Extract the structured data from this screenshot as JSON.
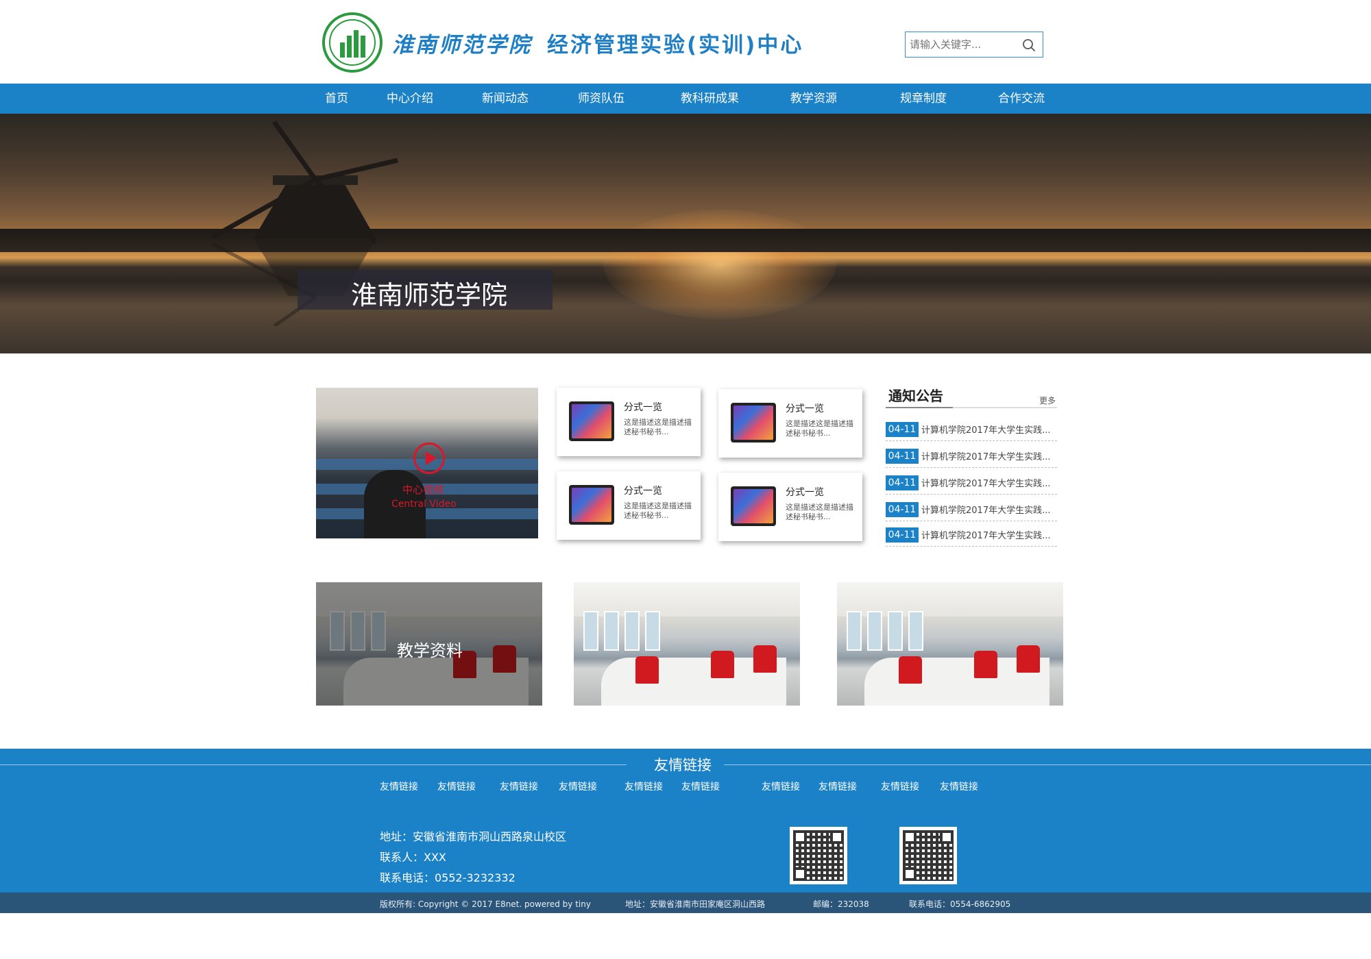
{
  "header": {
    "school_name": "淮南师范学院",
    "center_name": "经济管理实验(实训)中心",
    "search_placeholder": "请输入关键字..."
  },
  "nav": {
    "items": [
      {
        "label": "首页"
      },
      {
        "label": "中心介绍"
      },
      {
        "label": "新闻动态"
      },
      {
        "label": "师资队伍"
      },
      {
        "label": "教科研成果"
      },
      {
        "label": "教学资源"
      },
      {
        "label": "规章制度"
      },
      {
        "label": "合作交流"
      }
    ]
  },
  "banner": {
    "caption": "淮南师范学院",
    "slide_count": 4,
    "active_slide": 1
  },
  "video": {
    "title": "中心视频",
    "subtitle": "Central Video",
    "icon": "play-icon"
  },
  "cards": [
    {
      "title": "分式一览",
      "desc": "这是描述这是描述描述秘书秘书..."
    },
    {
      "title": "分式一览",
      "desc": "这是描述这是描述描述秘书秘书..."
    },
    {
      "title": "分式一览",
      "desc": "这是描述这是描述描述秘书秘书..."
    },
    {
      "title": "分式一览",
      "desc": "这是描述这是描述描述秘书秘书..."
    }
  ],
  "notice": {
    "title": "通知公告",
    "more": "更多",
    "items": [
      {
        "date": "04-11",
        "text": "计算机学院2017年大学生实践..."
      },
      {
        "date": "04-11",
        "text": "计算机学院2017年大学生实践..."
      },
      {
        "date": "04-11",
        "text": "计算机学院2017年大学生实践..."
      },
      {
        "date": "04-11",
        "text": "计算机学院2017年大学生实践..."
      },
      {
        "date": "04-11",
        "text": "计算机学院2017年大学生实践..."
      }
    ]
  },
  "gallery": {
    "first_label": "教学资料"
  },
  "footer": {
    "links_title": "友情链接",
    "links": [
      "友情链接",
      "友情链接",
      "友情链接",
      "友情链接",
      "友情链接",
      "友情链接",
      "友情链接",
      "友情链接",
      "友情链接",
      "友情链接"
    ],
    "address": "地址：安徽省淮南市洞山西路泉山校区",
    "contact": "联系人：XXX",
    "phone": "联系电话：0552-3232332"
  },
  "copyright": {
    "text": "版权所有: Copyright © 2017 E8net. powered by tiny",
    "address": "地址：安徽省淮南市田家庵区洞山西路",
    "postcode": "邮编：232038",
    "phone": "联系电话：0554-6862905"
  },
  "colors": {
    "brand_blue": "#1b82c7",
    "logo_green": "#2c9a3e",
    "copyright_bar": "#2a5579",
    "accent_red": "#d11a20"
  }
}
